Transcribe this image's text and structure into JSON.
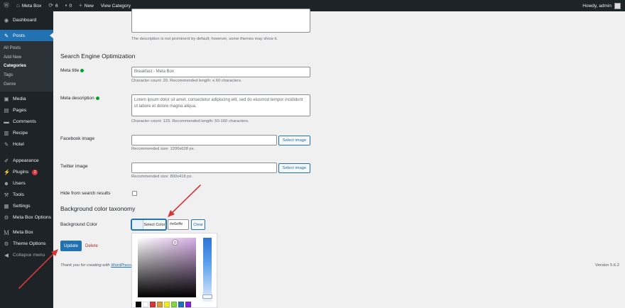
{
  "adminbar": {
    "site_name": "Meta Box",
    "updates_count": "6",
    "comments_count": "0",
    "new_label": "New",
    "view_label": "View Category",
    "howdy": "Howdy, admin"
  },
  "sidebar": {
    "dashboard": "Dashboard",
    "posts": "Posts",
    "sub_all_posts": "All Posts",
    "sub_add_new": "Add New",
    "sub_categories": "Categories",
    "sub_tags": "Tags",
    "sub_genre": "Genre",
    "media": "Media",
    "pages": "Pages",
    "comments": "Comments",
    "recipe": "Recipe",
    "hotel": "Hotel",
    "appearance": "Appearance",
    "plugins": "Plugins",
    "plugins_badge": "2",
    "users": "Users",
    "tools": "Tools",
    "settings": "Settings",
    "meta_box_options": "Meta Box Options",
    "meta_box": "Meta Box",
    "theme_options": "Theme Options",
    "collapse": "Collapse menu"
  },
  "main": {
    "description_note": "The description is not prominent by default; however, some themes may show it.",
    "seo_title": "Search Engine Optimization",
    "meta_title_label": "Meta title",
    "meta_title_value": "Breakfast - Meta Box",
    "meta_title_count": "Character count: 20. Recommended length: ≤ 60 characters.",
    "meta_desc_label": "Meta description",
    "meta_desc_value": "Lorem ipsum dolor sit amet, consectetur adipiscing elit, sed do eiusmod tempor incididunt ut labore et dolore magna aliqua.",
    "meta_desc_count": "Character count: 123. Recommended length: 50-160 characters.",
    "fb_label": "Facebook image",
    "fb_select": "Select image",
    "fb_size": "Recommended size: 1200x628 px.",
    "tw_label": "Twitter image",
    "tw_select": "Select image",
    "tw_size": "Recommended size: 800x418 px.",
    "hide_label": "Hide from search results",
    "bg_section_title": "Background color taxonomy",
    "bg_label": "Background Color",
    "select_color": "Select Color",
    "color_value": "#e6effe",
    "clear": "Clear",
    "update": "Update",
    "delete": "Delete",
    "footer_thanks": "Thank you for creating with",
    "footer_link": "WordPress",
    "version": "Version 5.6.2"
  },
  "colors": {
    "accent": "#2271b1",
    "sidebar_bg": "#1d2327",
    "selected_color": "#e6effe",
    "palette": [
      "#000000",
      "#ffffff",
      "#dd3333",
      "#dd9933",
      "#eeee22",
      "#81d742",
      "#1e73be",
      "#8224e3"
    ]
  }
}
